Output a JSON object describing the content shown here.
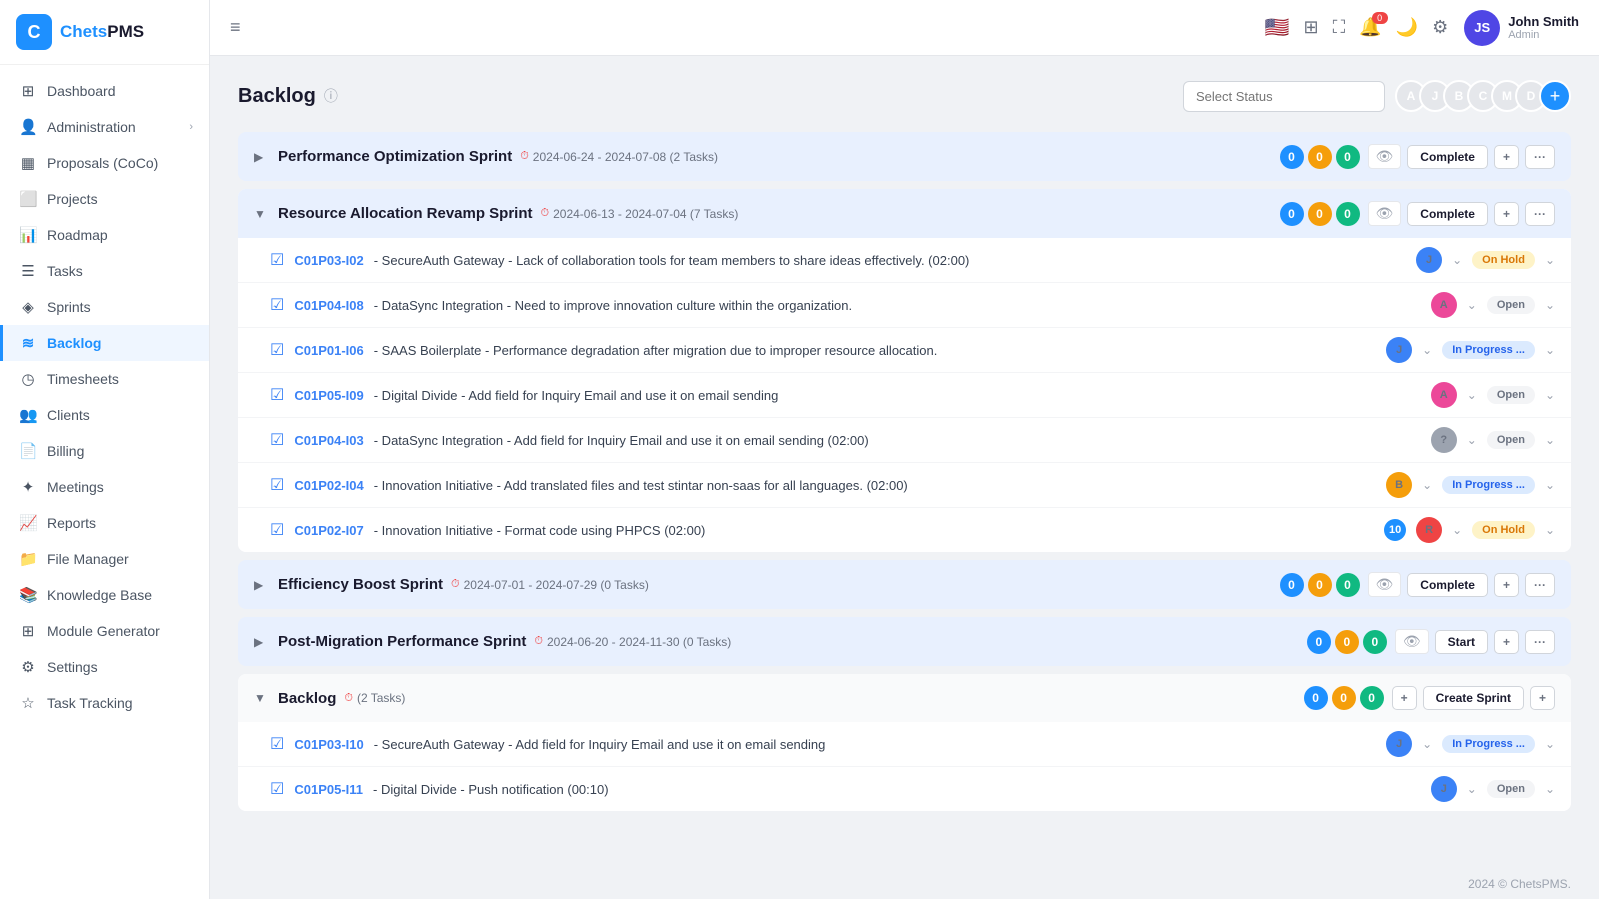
{
  "app": {
    "name": "ChetsPMS",
    "logo_letter": "C"
  },
  "sidebar": {
    "items": [
      {
        "id": "dashboard",
        "label": "Dashboard",
        "icon": "⊞",
        "active": false
      },
      {
        "id": "administration",
        "label": "Administration",
        "icon": "👤",
        "active": false,
        "has_arrow": true
      },
      {
        "id": "proposals",
        "label": "Proposals (CoCo)",
        "icon": "▦",
        "active": false
      },
      {
        "id": "projects",
        "label": "Projects",
        "icon": "⬜",
        "active": false
      },
      {
        "id": "roadmap",
        "label": "Roadmap",
        "icon": "📊",
        "active": false
      },
      {
        "id": "tasks",
        "label": "Tasks",
        "icon": "☰",
        "active": false
      },
      {
        "id": "sprints",
        "label": "Sprints",
        "icon": "◈",
        "active": false
      },
      {
        "id": "backlog",
        "label": "Backlog",
        "icon": "≋",
        "active": true
      },
      {
        "id": "timesheets",
        "label": "Timesheets",
        "icon": "◷",
        "active": false
      },
      {
        "id": "clients",
        "label": "Clients",
        "icon": "👥",
        "active": false
      },
      {
        "id": "billing",
        "label": "Billing",
        "icon": "📄",
        "active": false
      },
      {
        "id": "meetings",
        "label": "Meetings",
        "icon": "✦",
        "active": false
      },
      {
        "id": "reports",
        "label": "Reports",
        "icon": "📈",
        "active": false
      },
      {
        "id": "filemanager",
        "label": "File Manager",
        "icon": "📁",
        "active": false
      },
      {
        "id": "knowledgebase",
        "label": "Knowledge Base",
        "icon": "📚",
        "active": false
      },
      {
        "id": "modulegenerator",
        "label": "Module Generator",
        "icon": "⊞",
        "active": false
      },
      {
        "id": "settings",
        "label": "Settings",
        "icon": "⚙",
        "active": false
      },
      {
        "id": "tasktracking",
        "label": "Task Tracking",
        "icon": "☆",
        "active": false
      }
    ]
  },
  "topbar": {
    "hamburger": "≡",
    "notification_count": "0",
    "user": {
      "name": "John Smith",
      "role": "Admin"
    }
  },
  "page": {
    "title": "Backlog",
    "info_icon": "ⓘ",
    "select_status_placeholder": "Select Status",
    "add_member_icon": "+",
    "footer": "2024 © ChetsPMS."
  },
  "sprints": [
    {
      "id": "sprint1",
      "name": "Performance Optimization Sprint",
      "dates": "2024-06-24 - 2024-07-08 (2 Tasks)",
      "expanded": false,
      "counts": [
        0,
        0,
        0
      ],
      "action_label": "Complete",
      "bg": "blue",
      "tasks": []
    },
    {
      "id": "sprint2",
      "name": "Resource Allocation Revamp Sprint",
      "dates": "2024-06-13 - 2024-07-04 (7 Tasks)",
      "expanded": true,
      "counts": [
        0,
        0,
        0
      ],
      "action_label": "Complete",
      "bg": "blue",
      "tasks": [
        {
          "id": "C01P03-I02",
          "title": "SecureAuth Gateway - Lack of collaboration tools for team members to share ideas effectively.",
          "time": "(02:00)",
          "assignee_color": "av-blue",
          "assignee_initial": "J",
          "status": "On Hold",
          "status_class": "sb-onhold"
        },
        {
          "id": "C01P04-I08",
          "title": "DataSync Integration - Need to improve innovation culture within the organization.",
          "time": "",
          "assignee_color": "av-pink",
          "assignee_initial": "A",
          "status": "Open",
          "status_class": "sb-open"
        },
        {
          "id": "C01P01-I06",
          "title": "SAAS Boilerplate - Performance degradation after migration due to improper resource allocation.",
          "time": "",
          "assignee_color": "av-blue",
          "assignee_initial": "J",
          "status": "In Progress ...",
          "status_class": "sb-inprogress"
        },
        {
          "id": "C01P05-I09",
          "title": "Digital Divide - Add field for Inquiry Email and use it on email sending",
          "time": "",
          "assignee_color": "av-pink",
          "assignee_initial": "A",
          "status": "Open",
          "status_class": "sb-open"
        },
        {
          "id": "C01P04-I03",
          "title": "DataSync Integration - Add field for Inquiry Email and use it on email sending",
          "time": "(02:00)",
          "assignee_color": "av-gray",
          "assignee_initial": "?",
          "status": "Open",
          "status_class": "sb-open"
        },
        {
          "id": "C01P02-I04",
          "title": "Innovation Initiative - Add translated files and test stintar non-saas for all languages.",
          "time": "(02:00)",
          "assignee_color": "av-orange",
          "assignee_initial": "B",
          "status": "In Progress ...",
          "status_class": "sb-inprogress"
        },
        {
          "id": "C01P02-I07",
          "title": "Innovation Initiative - Format code using PHPCS",
          "time": "(02:00)",
          "assignee_color": "av-red",
          "assignee_initial": "R",
          "status": "On Hold",
          "status_class": "sb-onhold",
          "has_num_badge": true,
          "num_badge": "10"
        }
      ]
    },
    {
      "id": "sprint3",
      "name": "Efficiency Boost Sprint",
      "dates": "2024-07-01 - 2024-07-29 (0 Tasks)",
      "expanded": false,
      "counts": [
        0,
        0,
        0
      ],
      "action_label": "Complete",
      "bg": "blue",
      "tasks": []
    },
    {
      "id": "sprint4",
      "name": "Post-Migration Performance Sprint",
      "dates": "2024-06-20 - 2024-11-30 (0 Tasks)",
      "expanded": false,
      "counts": [
        0,
        0,
        0
      ],
      "action_label": "Start",
      "bg": "blue",
      "tasks": []
    }
  ],
  "backlog_section": {
    "name": "Backlog",
    "info": "(2 Tasks)",
    "counts": [
      0,
      0,
      0
    ],
    "create_sprint_label": "Create Sprint",
    "tasks": [
      {
        "id": "C01P03-I10",
        "title": "SecureAuth Gateway - Add field for Inquiry Email and use it on email sending",
        "time": "",
        "assignee_color": "av-blue",
        "assignee_initial": "J",
        "status": "In Progress ...",
        "status_class": "sb-inprogress"
      },
      {
        "id": "C01P05-I11",
        "title": "Digital Divide - Push notification",
        "time": "(00:10)",
        "assignee_color": "av-blue",
        "assignee_initial": "J",
        "status": "Open",
        "status_class": "sb-open"
      }
    ]
  }
}
